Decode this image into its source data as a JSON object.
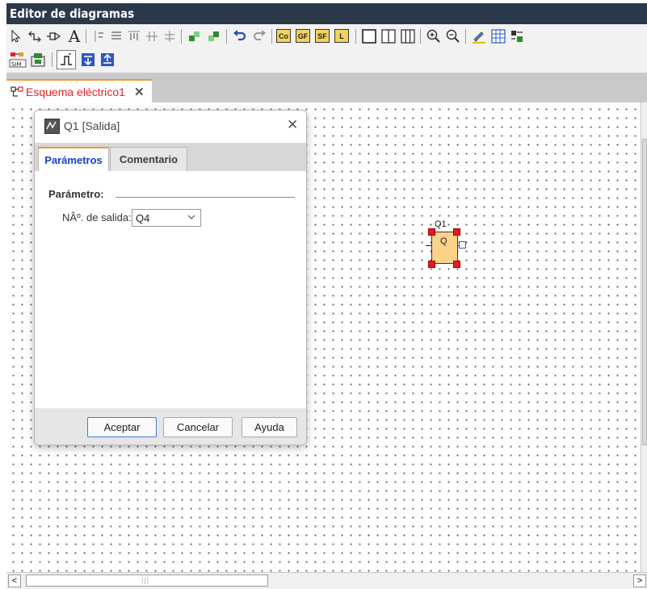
{
  "window": {
    "title": "Editor de diagramas"
  },
  "toolbar": {
    "row1": [
      "select-tool",
      "connect-tool",
      "block-tool",
      "text-tool",
      "align-tools",
      "arrange-tools",
      "undo",
      "redo",
      "Co",
      "GF",
      "SF",
      "L",
      "layout-single",
      "layout-double",
      "layout-triple",
      "zoom-in",
      "zoom-out",
      "edit",
      "table"
    ],
    "labels": {
      "co": "Co",
      "gf": "GF",
      "sf": "SF",
      "l": "L",
      "text_tool": "A"
    }
  },
  "document_tab": {
    "label": "Esquema eléctrico1",
    "close": "✕"
  },
  "dialog": {
    "title": "Q1 [Salida]",
    "close": "✕",
    "tabs": [
      {
        "label": "Parámetros",
        "active": true
      },
      {
        "label": "Comentario",
        "active": false
      }
    ],
    "section_label": "Parámetro:",
    "output_label": "NÂº. de salida:",
    "output_value": "Q4",
    "buttons": {
      "ok": "Aceptar",
      "cancel": "Cancelar",
      "help": "Ayuda"
    }
  },
  "diagram": {
    "block": {
      "name": "Q1",
      "symbol": "Q"
    }
  },
  "scrollbar": {
    "left_arrow": "<",
    "right_arrow": ">",
    "grip": "|||"
  },
  "colors": {
    "titlebar": "#2b394a",
    "accent_orange": "#f09a2e",
    "tab_text_red": "#e0262a",
    "active_tab_blue": "#1440c8",
    "block_fill": "#fbd28a",
    "handle_red": "#e81b1b"
  }
}
